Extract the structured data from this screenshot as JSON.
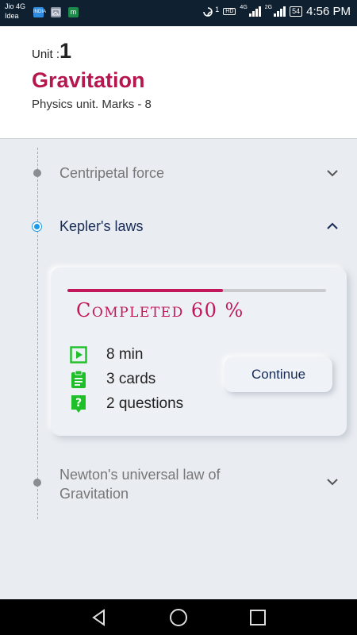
{
  "status_bar": {
    "carrier_1": "Jio 4G",
    "carrier_2": "Idea",
    "notif_icons": [
      "data-icon",
      "gallery-icon",
      "m-app-icon"
    ],
    "notif_icon_labels": [
      "INDIA",
      "",
      "m"
    ],
    "sync_count": "1",
    "hd_label": "HD",
    "net_1": "4G",
    "net_2": "2G",
    "battery": "54",
    "time": "4:56 PM"
  },
  "header": {
    "unit_label": "Unit :",
    "unit_number": "1",
    "title": "Gravitation",
    "subtitle": "Physics unit. Marks - 8"
  },
  "topics": [
    {
      "label": "Centripetal force",
      "expanded": false,
      "active": false
    },
    {
      "label": "Kepler's laws",
      "expanded": true,
      "active": true
    },
    {
      "label": "Newton's universal law of Gravitation",
      "expanded": false,
      "active": false
    }
  ],
  "topic_line_1": "Newton's universal law of",
  "topic_line_2": "Gravitation",
  "card": {
    "progress_percent": 60,
    "completed_text": "Completed 60 %",
    "stats": [
      {
        "icon": "play-video-icon",
        "text": "8 min"
      },
      {
        "icon": "clipboard-cards-icon",
        "text": "3 cards"
      },
      {
        "icon": "question-icon",
        "text": "2 questions"
      }
    ],
    "continue_label": "Continue"
  },
  "colors": {
    "accent": "#b5164e",
    "progress": "#c2185b",
    "active_dot": "#1a9be8",
    "stat_icon": "#1fbf2a",
    "active_text": "#162a55"
  },
  "nav": [
    "back-icon",
    "home-icon",
    "recents-icon"
  ]
}
